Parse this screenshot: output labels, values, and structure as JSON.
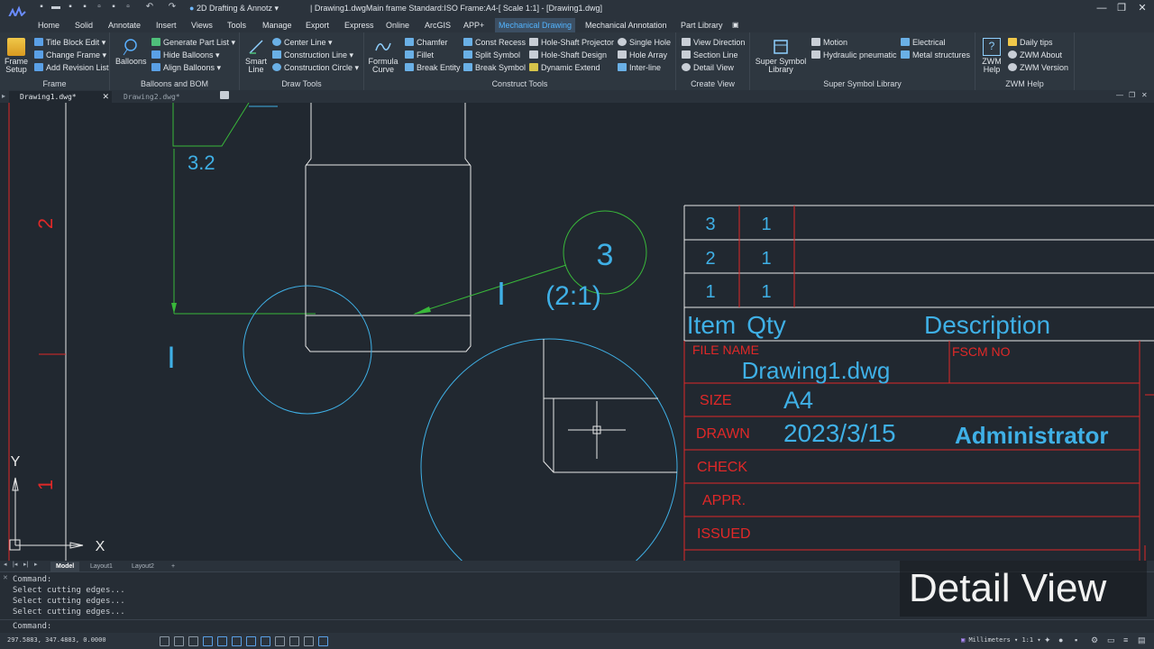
{
  "title_bar": {
    "workspace": "2D Drafting & Annotz",
    "window_title": "| Drawing1.dwgMain frame  Standard:ISO Frame:A4-[ Scale 1:1] - [Drawing1.dwg]"
  },
  "menu_tabs": [
    "Home",
    "Solid",
    "Annotate",
    "Insert",
    "Views",
    "Tools",
    "Manage",
    "Export",
    "Express",
    "Online",
    "ArcGIS",
    "APP+",
    "Mechanical Drawing",
    "Mechanical Annotation",
    "Part Library"
  ],
  "active_tab": "Mechanical Drawing",
  "ribbon": {
    "frame": {
      "label": "Frame",
      "frame_setup": "Frame Setup",
      "title_block_edit": "Title Block Edit",
      "change_frame": "Change Frame",
      "add_revision_list": "Add Revision List"
    },
    "balloons": {
      "label": "Balloons and BOM",
      "balloons": "Balloons",
      "generate_part_list": "Generate Part List",
      "hide_balloons": "Hide Balloons",
      "align_balloons": "Align Balloons"
    },
    "draw": {
      "label": "Draw Tools",
      "smart_line": "Smart Line",
      "center_line": "Center Line",
      "construction_line": "Construction Line",
      "construction_circle": "Construction Circle"
    },
    "construct": {
      "label": "Construct Tools",
      "formula_curve": "Formula Curve",
      "chamfer": "Chamfer",
      "fillet": "Fillet",
      "break_entity": "Break Entity",
      "const_recess": "Const Recess",
      "split_symbol": "Split Symbol",
      "break_symbol": "Break Symbol",
      "hole_shaft_projector": "Hole-Shaft Projector",
      "hole_shaft_design": "Hole-Shaft Design",
      "dynamic_extend": "Dynamic Extend",
      "single_hole": "Single Hole",
      "hole_array": "Hole Array",
      "inter_line": "Inter-line"
    },
    "view": {
      "label": "Create View",
      "view_direction": "View Direction",
      "section_line": "Section Line",
      "detail_view": "Detail View"
    },
    "symbol": {
      "label": "Super Symbol Library",
      "super_symbol_library": "Super Symbol Library",
      "motion": "Motion",
      "hydraulic_pneumatic": "Hydraulic pneumatic",
      "electrical": "Electrical",
      "metal_structures": "Metal structures"
    },
    "help": {
      "label": "ZWM Help",
      "zwm_help": "ZWM Help",
      "daily_tips": "Daily tips",
      "zwm_about": "ZWM About",
      "zwm_version": "ZWM Version"
    }
  },
  "doc_tabs": [
    "Drawing1.dwg*",
    "Drawing2.dwg*"
  ],
  "drawing": {
    "roughness": "3.2",
    "zone_2": "2",
    "zone_1": "1",
    "section_mark_left": "I",
    "section_mark_detail": "I",
    "detail_label": "3",
    "detail_scale": "(2:1)",
    "axis_y": "Y",
    "axis_x": "X"
  },
  "bom": {
    "rows": [
      {
        "item": "3",
        "qty": "1"
      },
      {
        "item": "2",
        "qty": "1"
      },
      {
        "item": "1",
        "qty": "1"
      }
    ],
    "header_item": "Item",
    "header_qty": "Qty",
    "header_desc": "Description"
  },
  "title_block": {
    "file_name_label": "FILE NAME",
    "file_name": "Drawing1.dwg",
    "fscm_label": "FSCM NO",
    "size_label": "SIZE",
    "size": "A4",
    "drawn_label": "DRAWN",
    "drawn_date": "2023/3/15",
    "drawn_by": "Administrator",
    "check_label": "CHECK",
    "appr_label": "APPR.",
    "issued_label": "ISSUED"
  },
  "layout_tabs": [
    "Model",
    "Layout1",
    "Layout2",
    "+"
  ],
  "command_lines": [
    "Command:",
    "Select cutting edges...",
    "Select cutting edges...",
    "Select cutting edges...",
    "Command:"
  ],
  "overlay_caption": "Detail View",
  "status": {
    "coords": "297.5883, 347.4883, 0.0000",
    "units": "Millimeters",
    "scale": "1:1"
  },
  "colors": {
    "cyan": "#3fb0e6",
    "red": "#e02828",
    "green": "#39b83a",
    "white": "#e8e8e8",
    "accent": "#52b4ff"
  }
}
